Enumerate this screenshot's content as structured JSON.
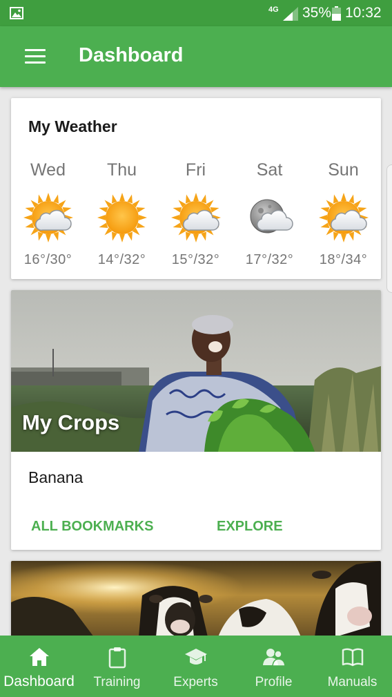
{
  "status_bar": {
    "network": "4G",
    "battery_percent": "35%",
    "time": "10:32"
  },
  "app_bar": {
    "title": "Dashboard",
    "menu_icon": "hamburger-menu-icon"
  },
  "weather": {
    "heading": "My Weather",
    "days": [
      {
        "name": "Wed",
        "temp": "16°/30°",
        "icon": "sun-cloud-icon"
      },
      {
        "name": "Thu",
        "temp": "14°/32°",
        "icon": "sun-icon"
      },
      {
        "name": "Fri",
        "temp": "15°/32°",
        "icon": "sun-cloud-icon"
      },
      {
        "name": "Sat",
        "temp": "17°/32°",
        "icon": "moon-cloud-icon"
      },
      {
        "name": "Sun",
        "temp": "18°/34°",
        "icon": "sun-cloud-icon"
      }
    ]
  },
  "crops": {
    "title": "My Crops",
    "crop": "Banana",
    "actions": {
      "bookmarks": "ALL BOOKMARKS",
      "explore": "EXPLORE"
    }
  },
  "bottom_nav": {
    "items": [
      {
        "label": "Dashboard",
        "icon": "home-icon",
        "active": true
      },
      {
        "label": "Training",
        "icon": "clipboard-icon",
        "active": false
      },
      {
        "label": "Experts",
        "icon": "graduation-cap-icon",
        "active": false
      },
      {
        "label": "Profile",
        "icon": "people-icon",
        "active": false
      },
      {
        "label": "Manuals",
        "icon": "book-icon",
        "active": false
      }
    ]
  },
  "colors": {
    "primary": "#4caf50",
    "primary_dark": "#3f9e3f",
    "text_secondary": "#757575"
  }
}
